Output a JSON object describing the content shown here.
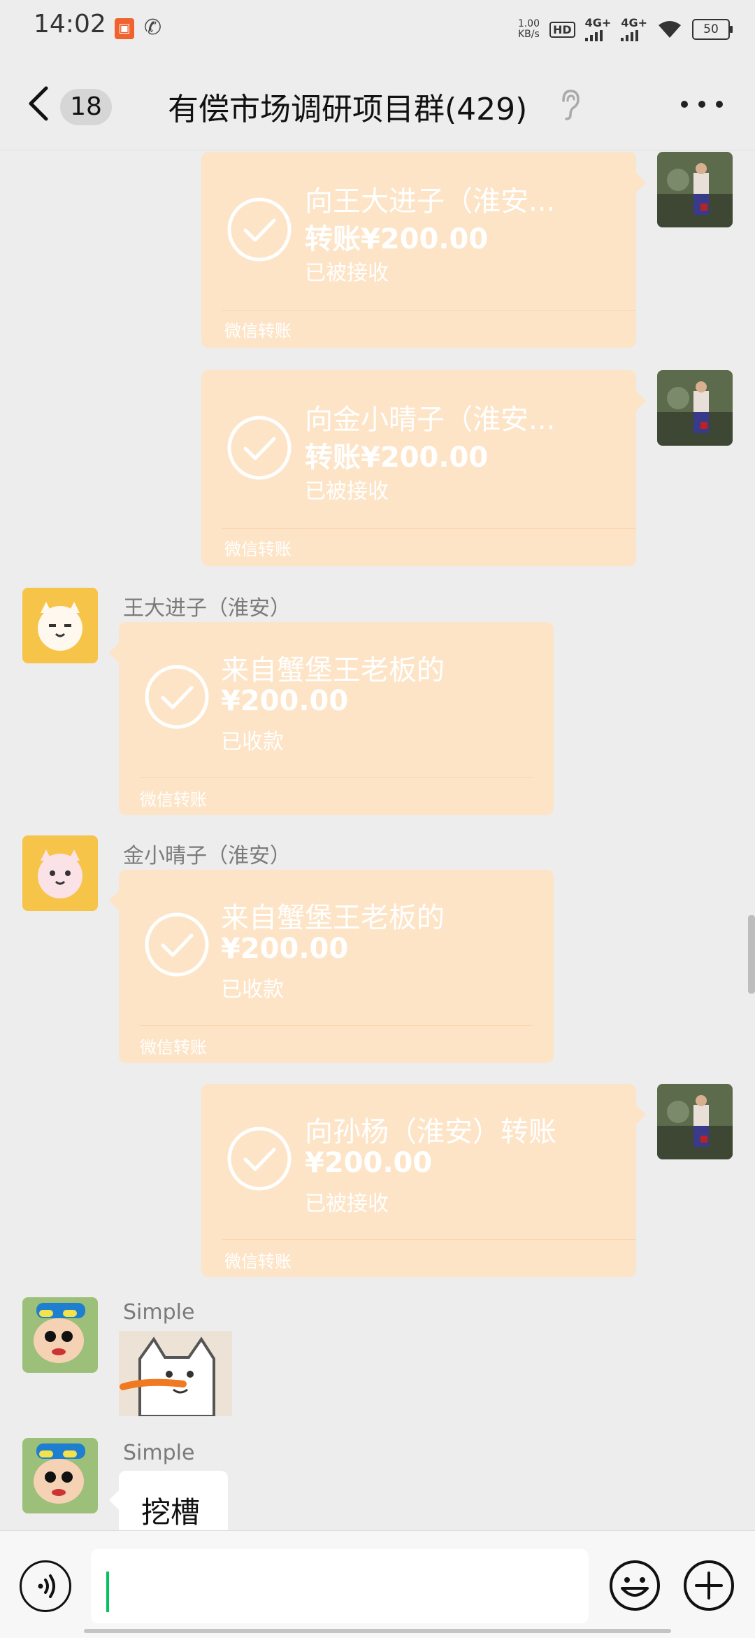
{
  "status_bar": {
    "time": "14:02",
    "net_speed_value": "1.00",
    "net_speed_unit": "KB/s",
    "hd_label": "HD",
    "sim1_label": "4G+",
    "sim2_label": "4G+",
    "battery_level": "50"
  },
  "header": {
    "unread_count": "18",
    "title": "有偿市场调研项目群(429)"
  },
  "messages": [
    {
      "side": "right",
      "kind": "transfer",
      "line1": "向王大进子（淮安...",
      "amount": "转账¥200.00",
      "status": "已被接收",
      "footer": "微信转账"
    },
    {
      "side": "right",
      "kind": "transfer",
      "line1": "向金小晴子（淮安...",
      "amount": "转账¥200.00",
      "status": "已被接收",
      "footer": "微信转账"
    },
    {
      "side": "left",
      "kind": "transfer",
      "sender": "王大进子（淮安）",
      "line1": "来自蟹堡王老板的",
      "amount": "¥200.00",
      "status": "已收款",
      "footer": "微信转账"
    },
    {
      "side": "left",
      "kind": "transfer",
      "sender": "金小晴子（淮安）",
      "line1": "来自蟹堡王老板的",
      "amount": "¥200.00",
      "status": "已收款",
      "footer": "微信转账"
    },
    {
      "side": "right",
      "kind": "transfer",
      "line1": "向孙杨（淮安）转账",
      "amount": "¥200.00",
      "status": "已被接收",
      "footer": "微信转账"
    },
    {
      "side": "left",
      "kind": "sticker",
      "sender": "Simple"
    },
    {
      "side": "left",
      "kind": "text",
      "sender": "Simple",
      "text": "挖槽"
    }
  ],
  "colors": {
    "transfer_bubble": "#fde4c7",
    "background": "#ededed",
    "caret": "#07c160"
  },
  "icons": {
    "back": "chevron-left-icon",
    "ear": "ear-icon",
    "more": "more-dots-icon",
    "voice": "voice-icon",
    "emoji": "emoji-icon",
    "plus": "plus-icon",
    "check": "check-circle-icon"
  }
}
